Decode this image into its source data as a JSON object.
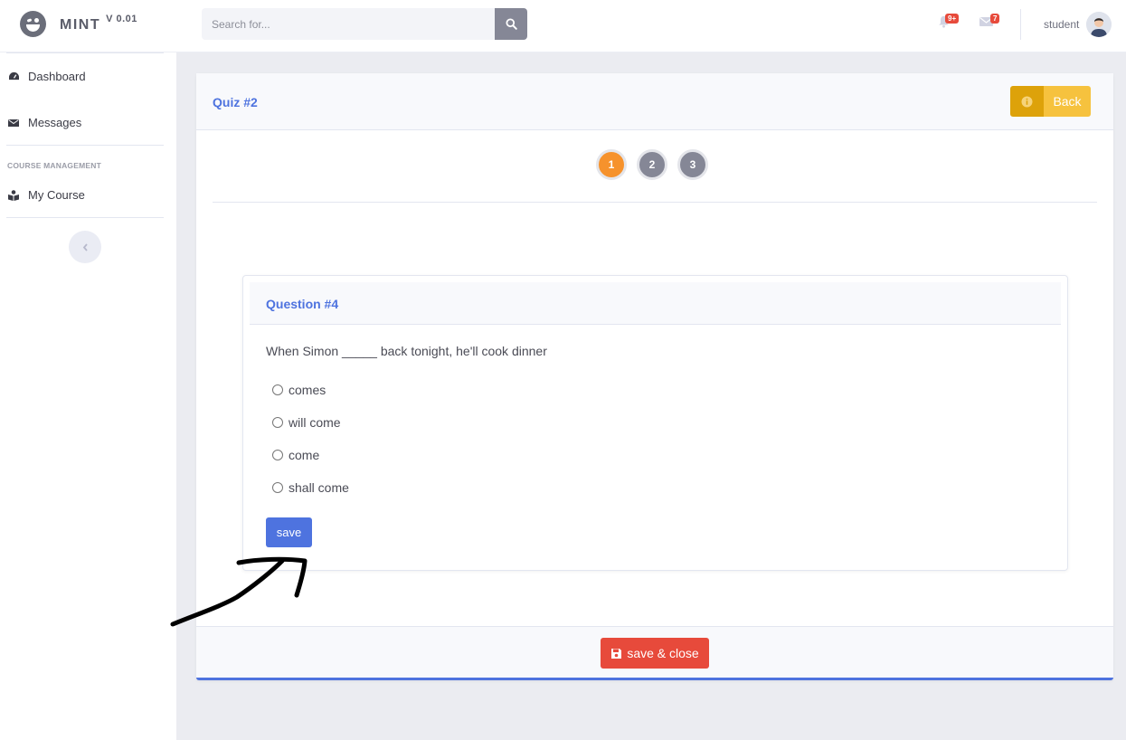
{
  "app": {
    "name": "MINT",
    "version": "V 0.01"
  },
  "search": {
    "placeholder": "Search for..."
  },
  "topbar": {
    "alerts_badge": "9+",
    "messages_badge": "7",
    "user_name": "student"
  },
  "sidebar": {
    "items": [
      {
        "label": "Dashboard",
        "icon": "tachometer-icon"
      },
      {
        "label": "Messages",
        "icon": "envelope-icon"
      }
    ],
    "section_heading": "COURSE MANAGEMENT",
    "course_items": [
      {
        "label": "My Course",
        "icon": "book-reader-icon"
      }
    ]
  },
  "quiz": {
    "title": "Quiz #2",
    "back_label": "Back",
    "steps": [
      "1",
      "2",
      "3"
    ],
    "active_step": "1",
    "question": {
      "title": "Question #4",
      "text": "When Simon _____ back tonight, he'll cook dinner",
      "options": [
        "comes",
        "will come",
        "come",
        "shall come"
      ],
      "save_label": "save"
    },
    "save_close_label": "save & close"
  },
  "colors": {
    "primary": "#4e73df",
    "warning": "#f6c23e",
    "danger": "#e74a3b",
    "active_step": "#f6922c",
    "inactive_step": "#858796"
  }
}
